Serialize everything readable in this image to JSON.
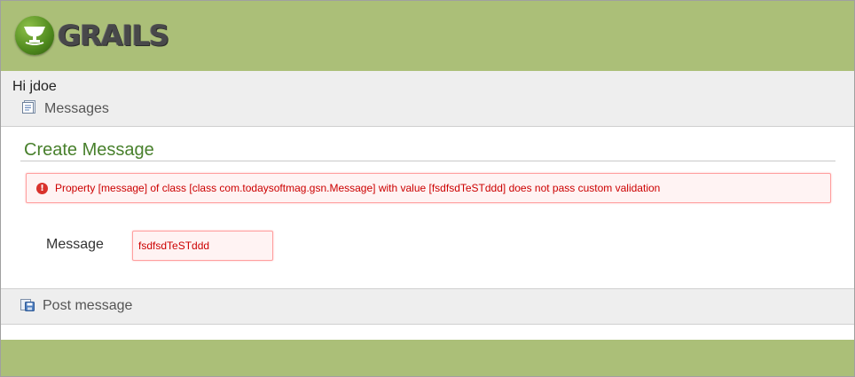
{
  "header": {
    "logo_text": "GRAILS",
    "logo_icon": "grails-cup-icon",
    "background_color": "#abbf78"
  },
  "nav": {
    "greeting": "Hi jdoe",
    "messages_label": "Messages",
    "messages_icon": "messages-list-icon"
  },
  "main": {
    "title": "Create Message",
    "error": {
      "icon": "error-icon",
      "text": "Property [message] of class [class com.todaysoftmag.gsn.Message] with value [fsdfsdTeSTddd] does not pass custom validation"
    },
    "form": {
      "message_label": "Message",
      "message_value": "fsdfsdTeSTddd"
    }
  },
  "buttons": {
    "post_label": "Post message",
    "post_icon": "save-icon"
  },
  "colors": {
    "brand_green": "#abbf78",
    "title_green": "#48802c",
    "error_red": "#cc0000",
    "error_bg": "#fff3f3"
  }
}
